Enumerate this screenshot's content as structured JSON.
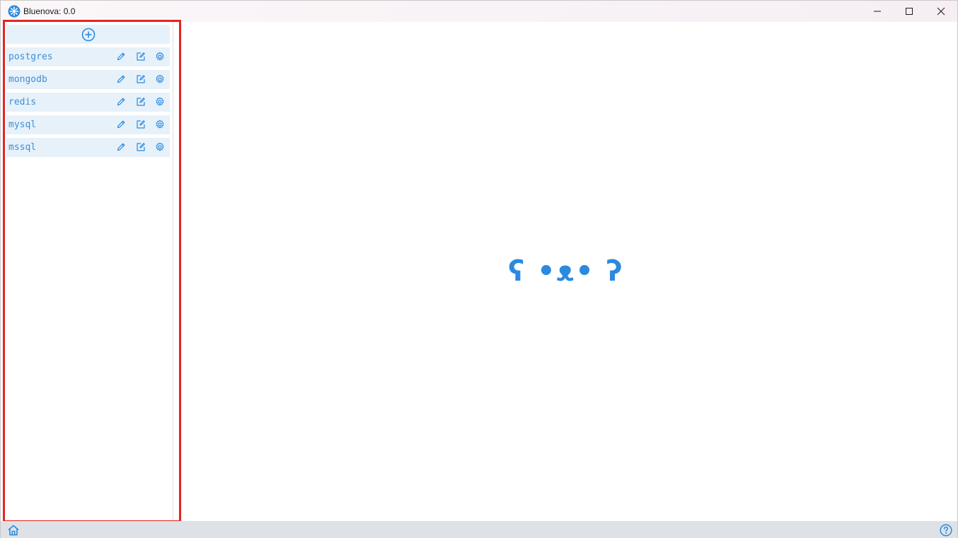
{
  "window": {
    "title": "Bluenova: 0.0"
  },
  "sidebar": {
    "add_icon": "plus-circle-icon",
    "connections": [
      {
        "label": "postgres"
      },
      {
        "label": "mongodb"
      },
      {
        "label": "redis"
      },
      {
        "label": "mysql"
      },
      {
        "label": "mssql"
      }
    ],
    "action_icons": [
      "pencil-icon",
      "edit-square-icon",
      "gear-icon"
    ]
  },
  "main": {
    "kaomoji": "ʕ •ᴥ• ʔ"
  },
  "statusbar": {
    "left_icon": "home-icon",
    "right_icon": "help-circle-icon"
  },
  "colors": {
    "accent": "#2a8ae0",
    "item_bg": "#e7f1fa",
    "highlight_border": "#e32424",
    "statusbar_bg": "#dee2e6"
  }
}
